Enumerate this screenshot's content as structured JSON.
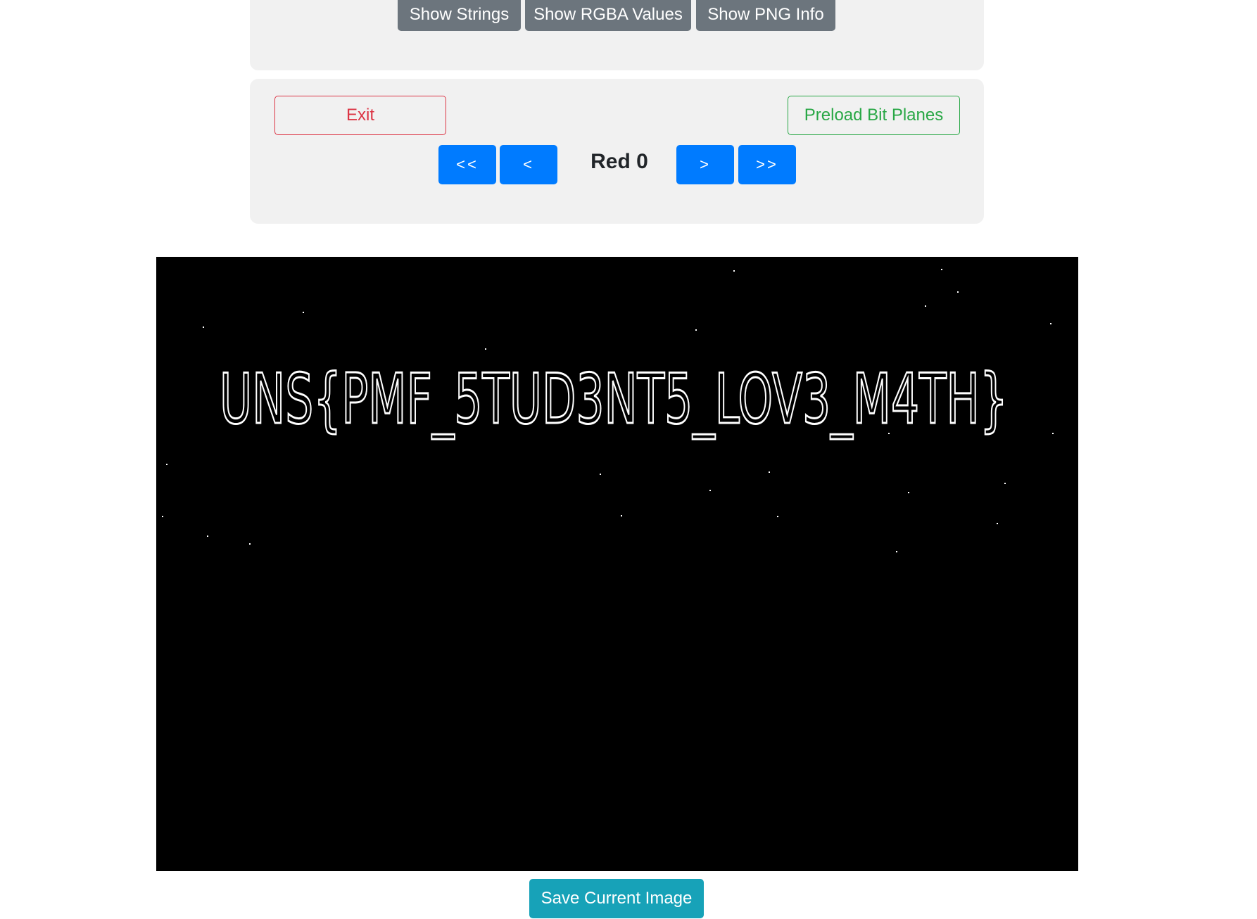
{
  "toolbar": {
    "show_strings": "Show Strings",
    "show_rgba": "Show RGBA Values",
    "show_png_info": "Show PNG Info"
  },
  "controls": {
    "exit": "Exit",
    "preload": "Preload Bit Planes",
    "first": "<<",
    "prev": "<",
    "next": ">",
    "last": ">>",
    "plane_label": "Red 0"
  },
  "image": {
    "flag_text": "UNS{PMF_5TUD3NT5_LOV3_M4TH}"
  },
  "save_button": "Save Current Image",
  "colors": {
    "secondary": "#6c757d",
    "danger": "#dc3545",
    "success": "#28a745",
    "primary": "#007bff",
    "info": "#17a2b8",
    "panel": "#f1f1f1"
  }
}
